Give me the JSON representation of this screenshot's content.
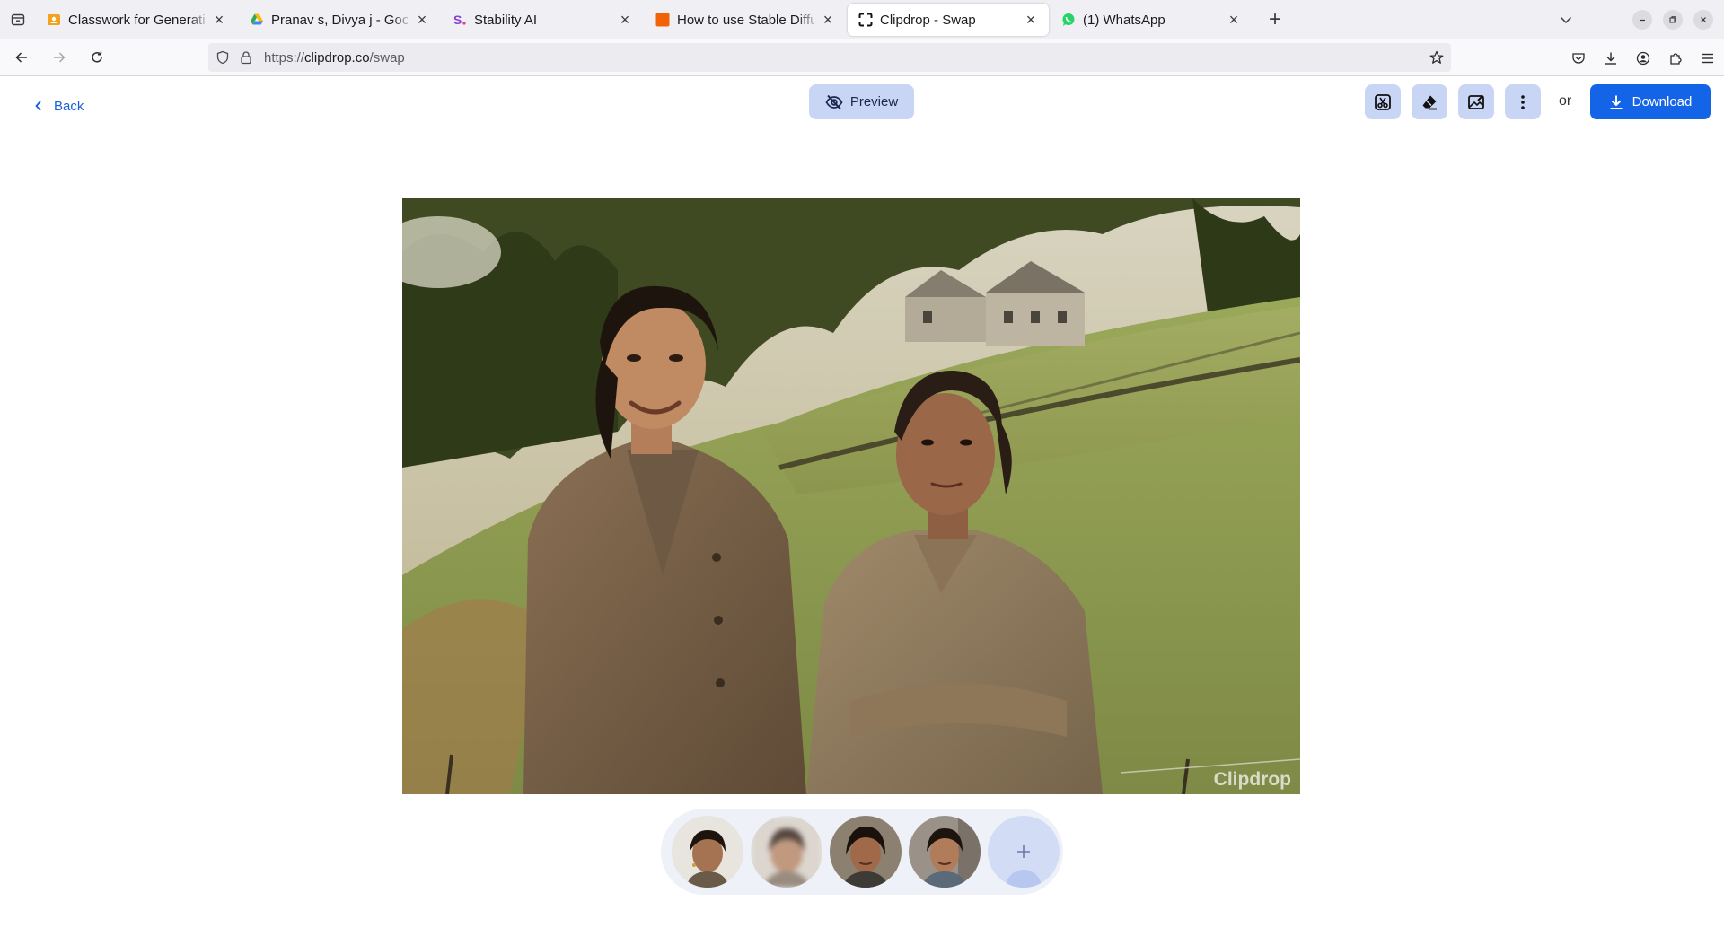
{
  "browser": {
    "tabs": [
      {
        "title": "Classwork for Generative",
        "favicon": "classroom-icon",
        "active": false
      },
      {
        "title": "Pranav s, Divya j - Google",
        "favicon": "google-drive-icon",
        "active": false
      },
      {
        "title": "Stability AI",
        "favicon": "stability-icon",
        "active": false
      },
      {
        "title": "How to use Stable Diffusi",
        "favicon": "orange-square-icon",
        "active": false
      },
      {
        "title": "Clipdrop - Swap",
        "favicon": "clipdrop-icon",
        "active": true
      },
      {
        "title": "(1) WhatsApp",
        "favicon": "whatsapp-icon",
        "active": false
      }
    ],
    "close_glyph": "×",
    "new_tab_glyph": "+",
    "url_prefix": "https://",
    "url_host": "clipdrop.co",
    "url_path": "/swap"
  },
  "page": {
    "back_label": "Back",
    "preview_label": "Preview",
    "or_label": "or",
    "download_label": "Download",
    "watermark": "Clipdrop"
  },
  "colors": {
    "accent": "#1464e8",
    "tool_button_bg": "#c9d5f4",
    "link": "#1a5fd8"
  }
}
